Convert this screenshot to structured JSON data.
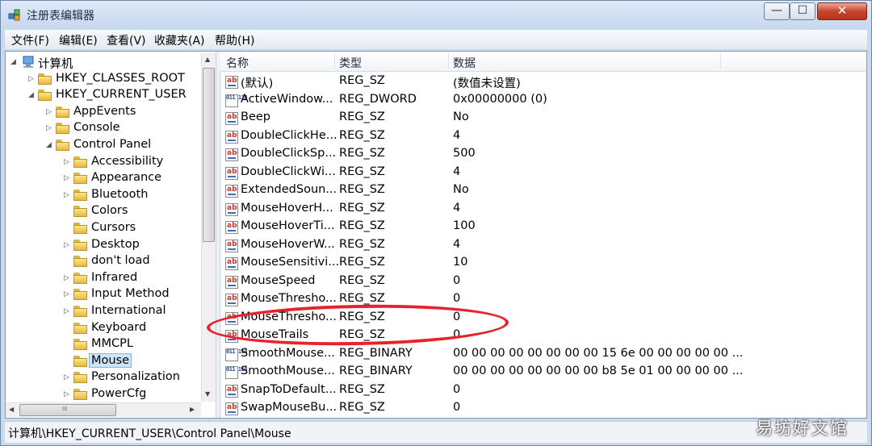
{
  "window": {
    "title": "注册表编辑器",
    "min_glyph": "—",
    "max_glyph": "☐",
    "close_glyph": "✕"
  },
  "menu": [
    "文件(F)",
    "编辑(E)",
    "查看(V)",
    "收藏夹(A)",
    "帮助(H)"
  ],
  "tree": {
    "items": [
      {
        "label": "计算机",
        "level": 0,
        "expander": "◢",
        "kind": "computer"
      },
      {
        "label": "HKEY_CLASSES_ROOT",
        "level": 1,
        "expander": "▷"
      },
      {
        "label": "HKEY_CURRENT_USER",
        "level": 1,
        "expander": "◢"
      },
      {
        "label": "AppEvents",
        "level": 2,
        "expander": "▷"
      },
      {
        "label": "Console",
        "level": 2,
        "expander": "▷"
      },
      {
        "label": "Control Panel",
        "level": 2,
        "expander": "◢"
      },
      {
        "label": "Accessibility",
        "level": 3,
        "expander": "▷"
      },
      {
        "label": "Appearance",
        "level": 3,
        "expander": "▷"
      },
      {
        "label": "Bluetooth",
        "level": 3,
        "expander": "▷"
      },
      {
        "label": "Colors",
        "level": 3,
        "expander": ""
      },
      {
        "label": "Cursors",
        "level": 3,
        "expander": ""
      },
      {
        "label": "Desktop",
        "level": 3,
        "expander": "▷"
      },
      {
        "label": "don't load",
        "level": 3,
        "expander": ""
      },
      {
        "label": "Infrared",
        "level": 3,
        "expander": "▷"
      },
      {
        "label": "Input Method",
        "level": 3,
        "expander": "▷"
      },
      {
        "label": "International",
        "level": 3,
        "expander": "▷"
      },
      {
        "label": "Keyboard",
        "level": 3,
        "expander": ""
      },
      {
        "label": "MMCPL",
        "level": 3,
        "expander": ""
      },
      {
        "label": "Mouse",
        "level": 3,
        "expander": "",
        "selected": true
      },
      {
        "label": "Personalization",
        "level": 3,
        "expander": "▷"
      },
      {
        "label": "PowerCfg",
        "level": 3,
        "expander": "▷"
      }
    ],
    "scroll_up": "▲",
    "scroll_down": "▼",
    "scroll_left": "◀",
    "scroll_right": "▶",
    "thumb_grip": "III"
  },
  "columns": {
    "name": "名称",
    "type": "类型",
    "data": "数据"
  },
  "values": [
    {
      "name": "(默认)",
      "type": "REG_SZ",
      "data": "(数值未设置)",
      "icon": "ab"
    },
    {
      "name": "ActiveWindow...",
      "type": "REG_DWORD",
      "data": "0x00000000 (0)",
      "icon": "bin"
    },
    {
      "name": "Beep",
      "type": "REG_SZ",
      "data": "No",
      "icon": "ab"
    },
    {
      "name": "DoubleClickHe...",
      "type": "REG_SZ",
      "data": "4",
      "icon": "ab"
    },
    {
      "name": "DoubleClickSp...",
      "type": "REG_SZ",
      "data": "500",
      "icon": "ab"
    },
    {
      "name": "DoubleClickWi...",
      "type": "REG_SZ",
      "data": "4",
      "icon": "ab"
    },
    {
      "name": "ExtendedSoun...",
      "type": "REG_SZ",
      "data": "No",
      "icon": "ab"
    },
    {
      "name": "MouseHoverH...",
      "type": "REG_SZ",
      "data": "4",
      "icon": "ab"
    },
    {
      "name": "MouseHoverTi...",
      "type": "REG_SZ",
      "data": "100",
      "icon": "ab"
    },
    {
      "name": "MouseHoverW...",
      "type": "REG_SZ",
      "data": "4",
      "icon": "ab"
    },
    {
      "name": "MouseSensitivi...",
      "type": "REG_SZ",
      "data": "10",
      "icon": "ab"
    },
    {
      "name": "MouseSpeed",
      "type": "REG_SZ",
      "data": "0",
      "icon": "ab"
    },
    {
      "name": "MouseThresho...",
      "type": "REG_SZ",
      "data": "0",
      "icon": "ab"
    },
    {
      "name": "MouseThresho...",
      "type": "REG_SZ",
      "data": "0",
      "icon": "ab"
    },
    {
      "name": "MouseTrails",
      "type": "REG_SZ",
      "data": "0",
      "icon": "ab"
    },
    {
      "name": "SmoothMouse...",
      "type": "REG_BINARY",
      "data": "00 00 00 00 00 00 00 00 15 6e 00 00 00 00 00 ...",
      "icon": "bin"
    },
    {
      "name": "SmoothMouse...",
      "type": "REG_BINARY",
      "data": "00 00 00 00 00 00 00 00 b8 5e 01 00 00 00 00 ...",
      "icon": "bin"
    },
    {
      "name": "SnapToDefault...",
      "type": "REG_SZ",
      "data": "0",
      "icon": "ab"
    },
    {
      "name": "SwapMouseBu...",
      "type": "REG_SZ",
      "data": "0",
      "icon": "ab"
    }
  ],
  "icon_text": {
    "ab": "ab",
    "bin": "011 110"
  },
  "status": {
    "path": "计算机\\HKEY_CURRENT_USER\\Control Panel\\Mouse"
  },
  "watermark": "易坊好文馆",
  "colors": {
    "annotation": "#e8212a",
    "selection": "#cde4f7"
  }
}
